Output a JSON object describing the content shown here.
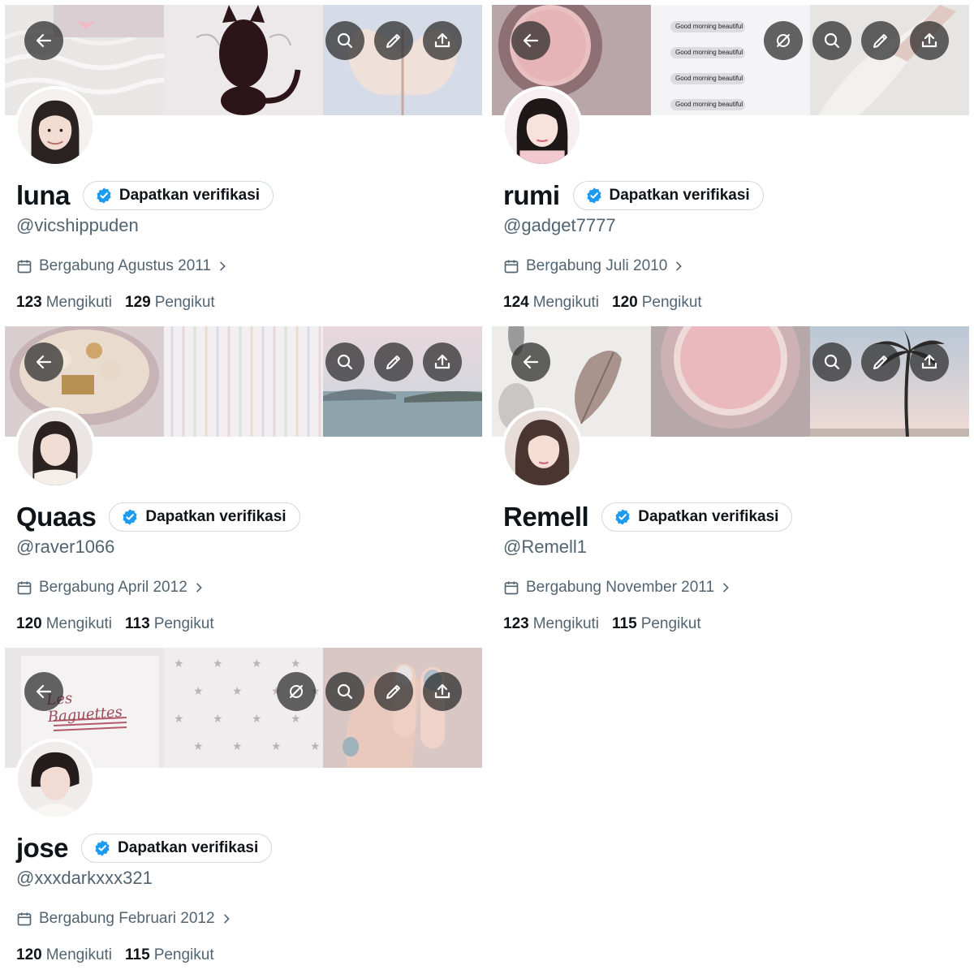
{
  "verify_label": "Dapatkan verifikasi",
  "following_label": "Mengikuti",
  "followers_label": "Pengikut",
  "profiles": [
    {
      "name": "luna",
      "handle": "@vicshippuden",
      "joined": "Bergabung Agustus 2011",
      "following": "123",
      "followers": "129",
      "header_icons": [
        "back-arrow-icon",
        "search-icon",
        "edit-pencil-icon",
        "share-icon"
      ]
    },
    {
      "name": "rumi",
      "handle": "@gadget7777",
      "joined": "Bergabung Juli 2010",
      "following": "124",
      "followers": "120",
      "header_icons": [
        "back-arrow-icon",
        "hide-icon",
        "search-icon",
        "edit-pencil-icon",
        "share-icon"
      ],
      "banner_messages": [
        "Good morning beautiful",
        "Good morning beautiful",
        "Good morning beautiful",
        "Good morning beautiful"
      ]
    },
    {
      "name": "Quaas",
      "handle": "@raver1066",
      "joined": "Bergabung April 2012",
      "following": "120",
      "followers": "113",
      "header_icons": [
        "back-arrow-icon",
        "search-icon",
        "edit-pencil-icon",
        "share-icon"
      ]
    },
    {
      "name": "Remell",
      "handle": "@Remell1",
      "joined": "Bergabung November 2011",
      "following": "123",
      "followers": "115",
      "header_icons": [
        "back-arrow-icon",
        "search-icon",
        "edit-pencil-icon",
        "share-icon"
      ]
    },
    {
      "name": "jose",
      "handle": "@xxxdarkxxx321",
      "joined": "Bergabung Februari 2012",
      "following": "120",
      "followers": "115",
      "header_icons": [
        "back-arrow-icon",
        "hide-icon",
        "search-icon",
        "edit-pencil-icon",
        "share-icon"
      ],
      "banner_text": "Les Baguettes"
    }
  ],
  "colors": {
    "verified_blue": "#1d9bf0",
    "secondary_text": "#536471",
    "primary_text": "#0f1419",
    "button_border": "#cfd9de"
  }
}
